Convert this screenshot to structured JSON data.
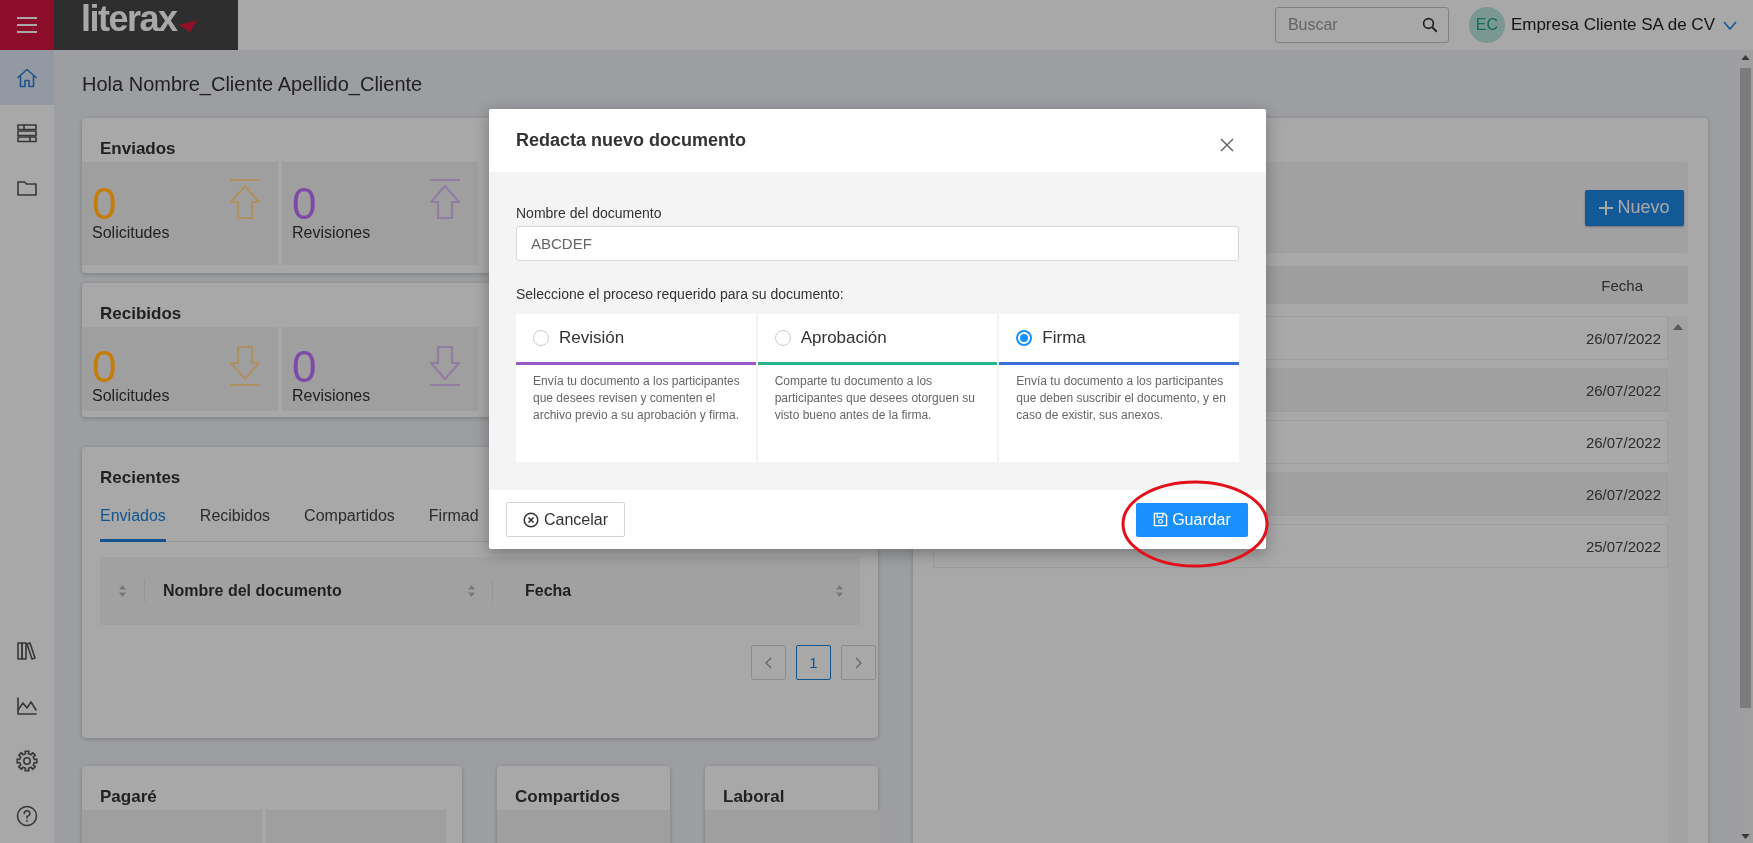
{
  "topbar": {
    "logo": "literax",
    "search": {
      "placeholder": "Buscar"
    },
    "user": {
      "initials": "EC",
      "name": "Empresa Cliente SA de CV"
    }
  },
  "sidebar": {
    "top_items": [
      {
        "selected": true
      },
      {
        "selected": false
      },
      {
        "selected": false
      }
    ],
    "bottom_items": [
      {
        "selected": false
      },
      {
        "selected": false
      },
      {
        "selected": false
      },
      {
        "selected": false
      }
    ]
  },
  "greeting": "Hola Nombre_Cliente Apellido_Cliente",
  "summary_cards": [
    {
      "title": "Enviados",
      "kind": "sent",
      "stats": [
        {
          "value": "0",
          "label": "Solicitudes",
          "color": "#c47d08"
        },
        {
          "value": "0",
          "label": "Revisiones",
          "color": "#7d4aa8"
        }
      ]
    },
    {
      "title": "Recibidos",
      "kind": "received",
      "stats": [
        {
          "value": "0",
          "label": "Solicitudes",
          "color": "#c47d08"
        },
        {
          "value": "0",
          "label": "Revisiones",
          "color": "#7d4aa8"
        }
      ]
    }
  ],
  "recent": {
    "title": "Recientes",
    "tabs": [
      {
        "label": "Enviados",
        "selected": true
      },
      {
        "label": "Recibidos",
        "selected": false
      },
      {
        "label": "Compartidos",
        "selected": false
      },
      {
        "label": "Firmad",
        "selected": false
      }
    ],
    "columns": [
      "Nombre del documento",
      "Fecha"
    ],
    "pages": [
      {
        "label": "1",
        "selected": true
      }
    ]
  },
  "bottom_cards": [
    {
      "title": "Pagaré",
      "tiles": [
        {
          "kind": "stat"
        },
        {
          "kind": "stat"
        }
      ]
    },
    {
      "title": "Compartidos",
      "tiles": [
        {
          "kind": "stat"
        }
      ]
    },
    {
      "title": "Laboral",
      "tiles": [
        {
          "kind": "stat"
        }
      ]
    }
  ],
  "documents": {
    "new_button": "Nuevo",
    "columns": [
      "Fecha"
    ],
    "rows": [
      {
        "date": "26/07/2022"
      },
      {
        "date": "26/07/2022"
      },
      {
        "date": "26/07/2022"
      },
      {
        "date": "26/07/2022"
      },
      {
        "date": "25/07/2022"
      }
    ]
  },
  "dialog": {
    "title": "Redacta nuevo documento",
    "name_field": {
      "label": "Nombre del documento",
      "value": "ABCDEF"
    },
    "process_prompt": "Seleccione el proceso requerido para su documento:",
    "options": [
      {
        "label": "Revisión",
        "description": "Envía tu documento a los participantes que desees revisen y comenten el archivo previo a su aprobación y firma.",
        "color": "#9b59c6",
        "selected": false
      },
      {
        "label": "Aprobación",
        "description": "Comparte tu documento a los participantes que desees otorguen su visto bueno antes de la firma.",
        "color": "#26b48c",
        "selected": false
      },
      {
        "label": "Firma",
        "description": "Envía tu documento a los participantes que deben suscribir el documento, y en caso de existir, sus anexos.",
        "color": "#3a6fd8",
        "selected": true
      }
    ],
    "buttons": [
      {
        "kind": "cancel",
        "label": "Cancelar"
      },
      {
        "kind": "save",
        "label": "Guardar"
      }
    ]
  },
  "annotation": {
    "kind": "ellipse"
  }
}
